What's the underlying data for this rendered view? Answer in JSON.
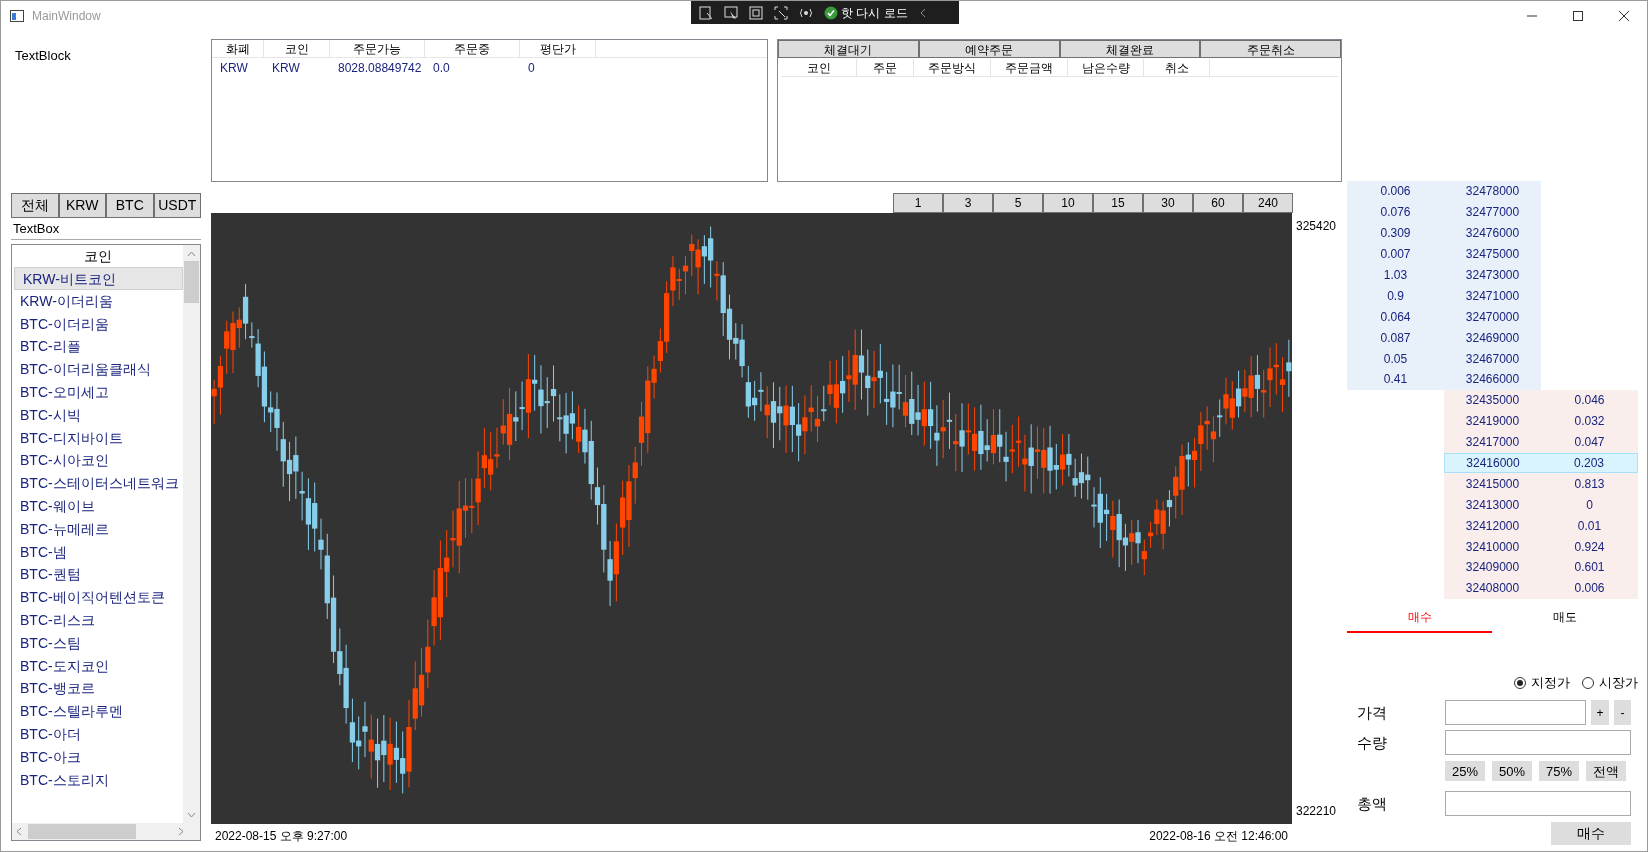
{
  "window": {
    "title": "MainWindow"
  },
  "debug_toolbar": {
    "hot_reload": "핫 다시 로드"
  },
  "text_block": "TextBlock",
  "balance_table": {
    "columns": [
      "화폐",
      "코인",
      "주문가능",
      "주문중",
      "평단가"
    ],
    "rows": [
      [
        "KRW",
        "KRW",
        "8028.08849742",
        "0.0",
        "0"
      ]
    ]
  },
  "order_tabs": [
    {
      "label": "체결대기",
      "selected": false
    },
    {
      "label": "예약주문",
      "selected": false
    },
    {
      "label": "체결완료",
      "selected": false
    },
    {
      "label": "주문취소",
      "selected": false
    }
  ],
  "order_table": {
    "columns": [
      "코인",
      "주문",
      "주문방식",
      "주문금액",
      "남은수량",
      "취소"
    ]
  },
  "market_tabs": [
    "전체",
    "KRW",
    "BTC",
    "USDT"
  ],
  "search": {
    "value": "TextBox"
  },
  "coin_list": {
    "header": "코인",
    "items": [
      {
        "label": "KRW-비트코인",
        "selected": true
      },
      {
        "label": "KRW-이더리움",
        "selected": false
      },
      {
        "label": "BTC-이더리움",
        "selected": false
      },
      {
        "label": "BTC-리플",
        "selected": false
      },
      {
        "label": "BTC-이더리움클래식",
        "selected": false
      },
      {
        "label": "BTC-오미세고",
        "selected": false
      },
      {
        "label": "BTC-시빅",
        "selected": false
      },
      {
        "label": "BTC-디지바이트",
        "selected": false
      },
      {
        "label": "BTC-시아코인",
        "selected": false
      },
      {
        "label": "BTC-스테이터스네트워크",
        "selected": false
      },
      {
        "label": "BTC-웨이브",
        "selected": false
      },
      {
        "label": "BTC-뉴메레르",
        "selected": false
      },
      {
        "label": "BTC-넴",
        "selected": false
      },
      {
        "label": "BTC-퀀텀",
        "selected": false
      },
      {
        "label": "BTC-베이직어텐션토큰",
        "selected": false
      },
      {
        "label": "BTC-리스크",
        "selected": false
      },
      {
        "label": "BTC-스팀",
        "selected": false
      },
      {
        "label": "BTC-도지코인",
        "selected": false
      },
      {
        "label": "BTC-뱅코르",
        "selected": false
      },
      {
        "label": "BTC-스텔라루멘",
        "selected": false
      },
      {
        "label": "BTC-아더",
        "selected": false
      },
      {
        "label": "BTC-아크",
        "selected": false
      },
      {
        "label": "BTC-스토리지",
        "selected": false
      }
    ]
  },
  "intervals": [
    {
      "label": "1",
      "selected": false
    },
    {
      "label": "3",
      "selected": false
    },
    {
      "label": "5",
      "selected": false
    },
    {
      "label": "10",
      "selected": false
    },
    {
      "label": "15",
      "selected": false
    },
    {
      "label": "30",
      "selected": false
    },
    {
      "label": "60",
      "selected": false
    },
    {
      "label": "240",
      "selected": false
    }
  ],
  "chart": {
    "price_high": "325420",
    "price_low": "322210",
    "time_start": "2022-08-15 오후 9:27:00",
    "time_end": "2022-08-16 오전 12:46:00"
  },
  "asks": [
    {
      "quantity": "0.006",
      "price": "32478000"
    },
    {
      "quantity": "0.076",
      "price": "32477000"
    },
    {
      "quantity": "0.309",
      "price": "32476000"
    },
    {
      "quantity": "0.007",
      "price": "32475000"
    },
    {
      "quantity": "1.03",
      "price": "32473000"
    },
    {
      "quantity": "0.9",
      "price": "32471000"
    },
    {
      "quantity": "0.064",
      "price": "32470000"
    },
    {
      "quantity": "0.087",
      "price": "32469000"
    },
    {
      "quantity": "0.05",
      "price": "32467000"
    },
    {
      "quantity": "0.41",
      "price": "32466000"
    }
  ],
  "bids": [
    {
      "price": "32435000",
      "quantity": "0.046",
      "selected": false
    },
    {
      "price": "32419000",
      "quantity": "0.032",
      "selected": false
    },
    {
      "price": "32417000",
      "quantity": "0.047",
      "selected": false
    },
    {
      "price": "32416000",
      "quantity": "0.203",
      "selected": true
    },
    {
      "price": "32415000",
      "quantity": "0.813",
      "selected": false
    },
    {
      "price": "32413000",
      "quantity": "0",
      "selected": false
    },
    {
      "price": "32412000",
      "quantity": "0.01",
      "selected": false
    },
    {
      "price": "32410000",
      "quantity": "0.924",
      "selected": false
    },
    {
      "price": "32409000",
      "quantity": "0.601",
      "selected": false
    },
    {
      "price": "32408000",
      "quantity": "0.006",
      "selected": false
    }
  ],
  "trade_tabs": [
    {
      "label": "매수",
      "selected": true
    },
    {
      "label": "매도",
      "selected": false
    }
  ],
  "order_types": [
    {
      "label": "지정가",
      "selected": true
    },
    {
      "label": "시장가",
      "selected": false
    }
  ],
  "form": {
    "price_label": "가격",
    "plus": "+",
    "minus": "-",
    "quantity_label": "수량",
    "percent_buttons": [
      "25%",
      "50%",
      "75%",
      "전액"
    ],
    "total_label": "총액",
    "submit": "매수"
  }
}
